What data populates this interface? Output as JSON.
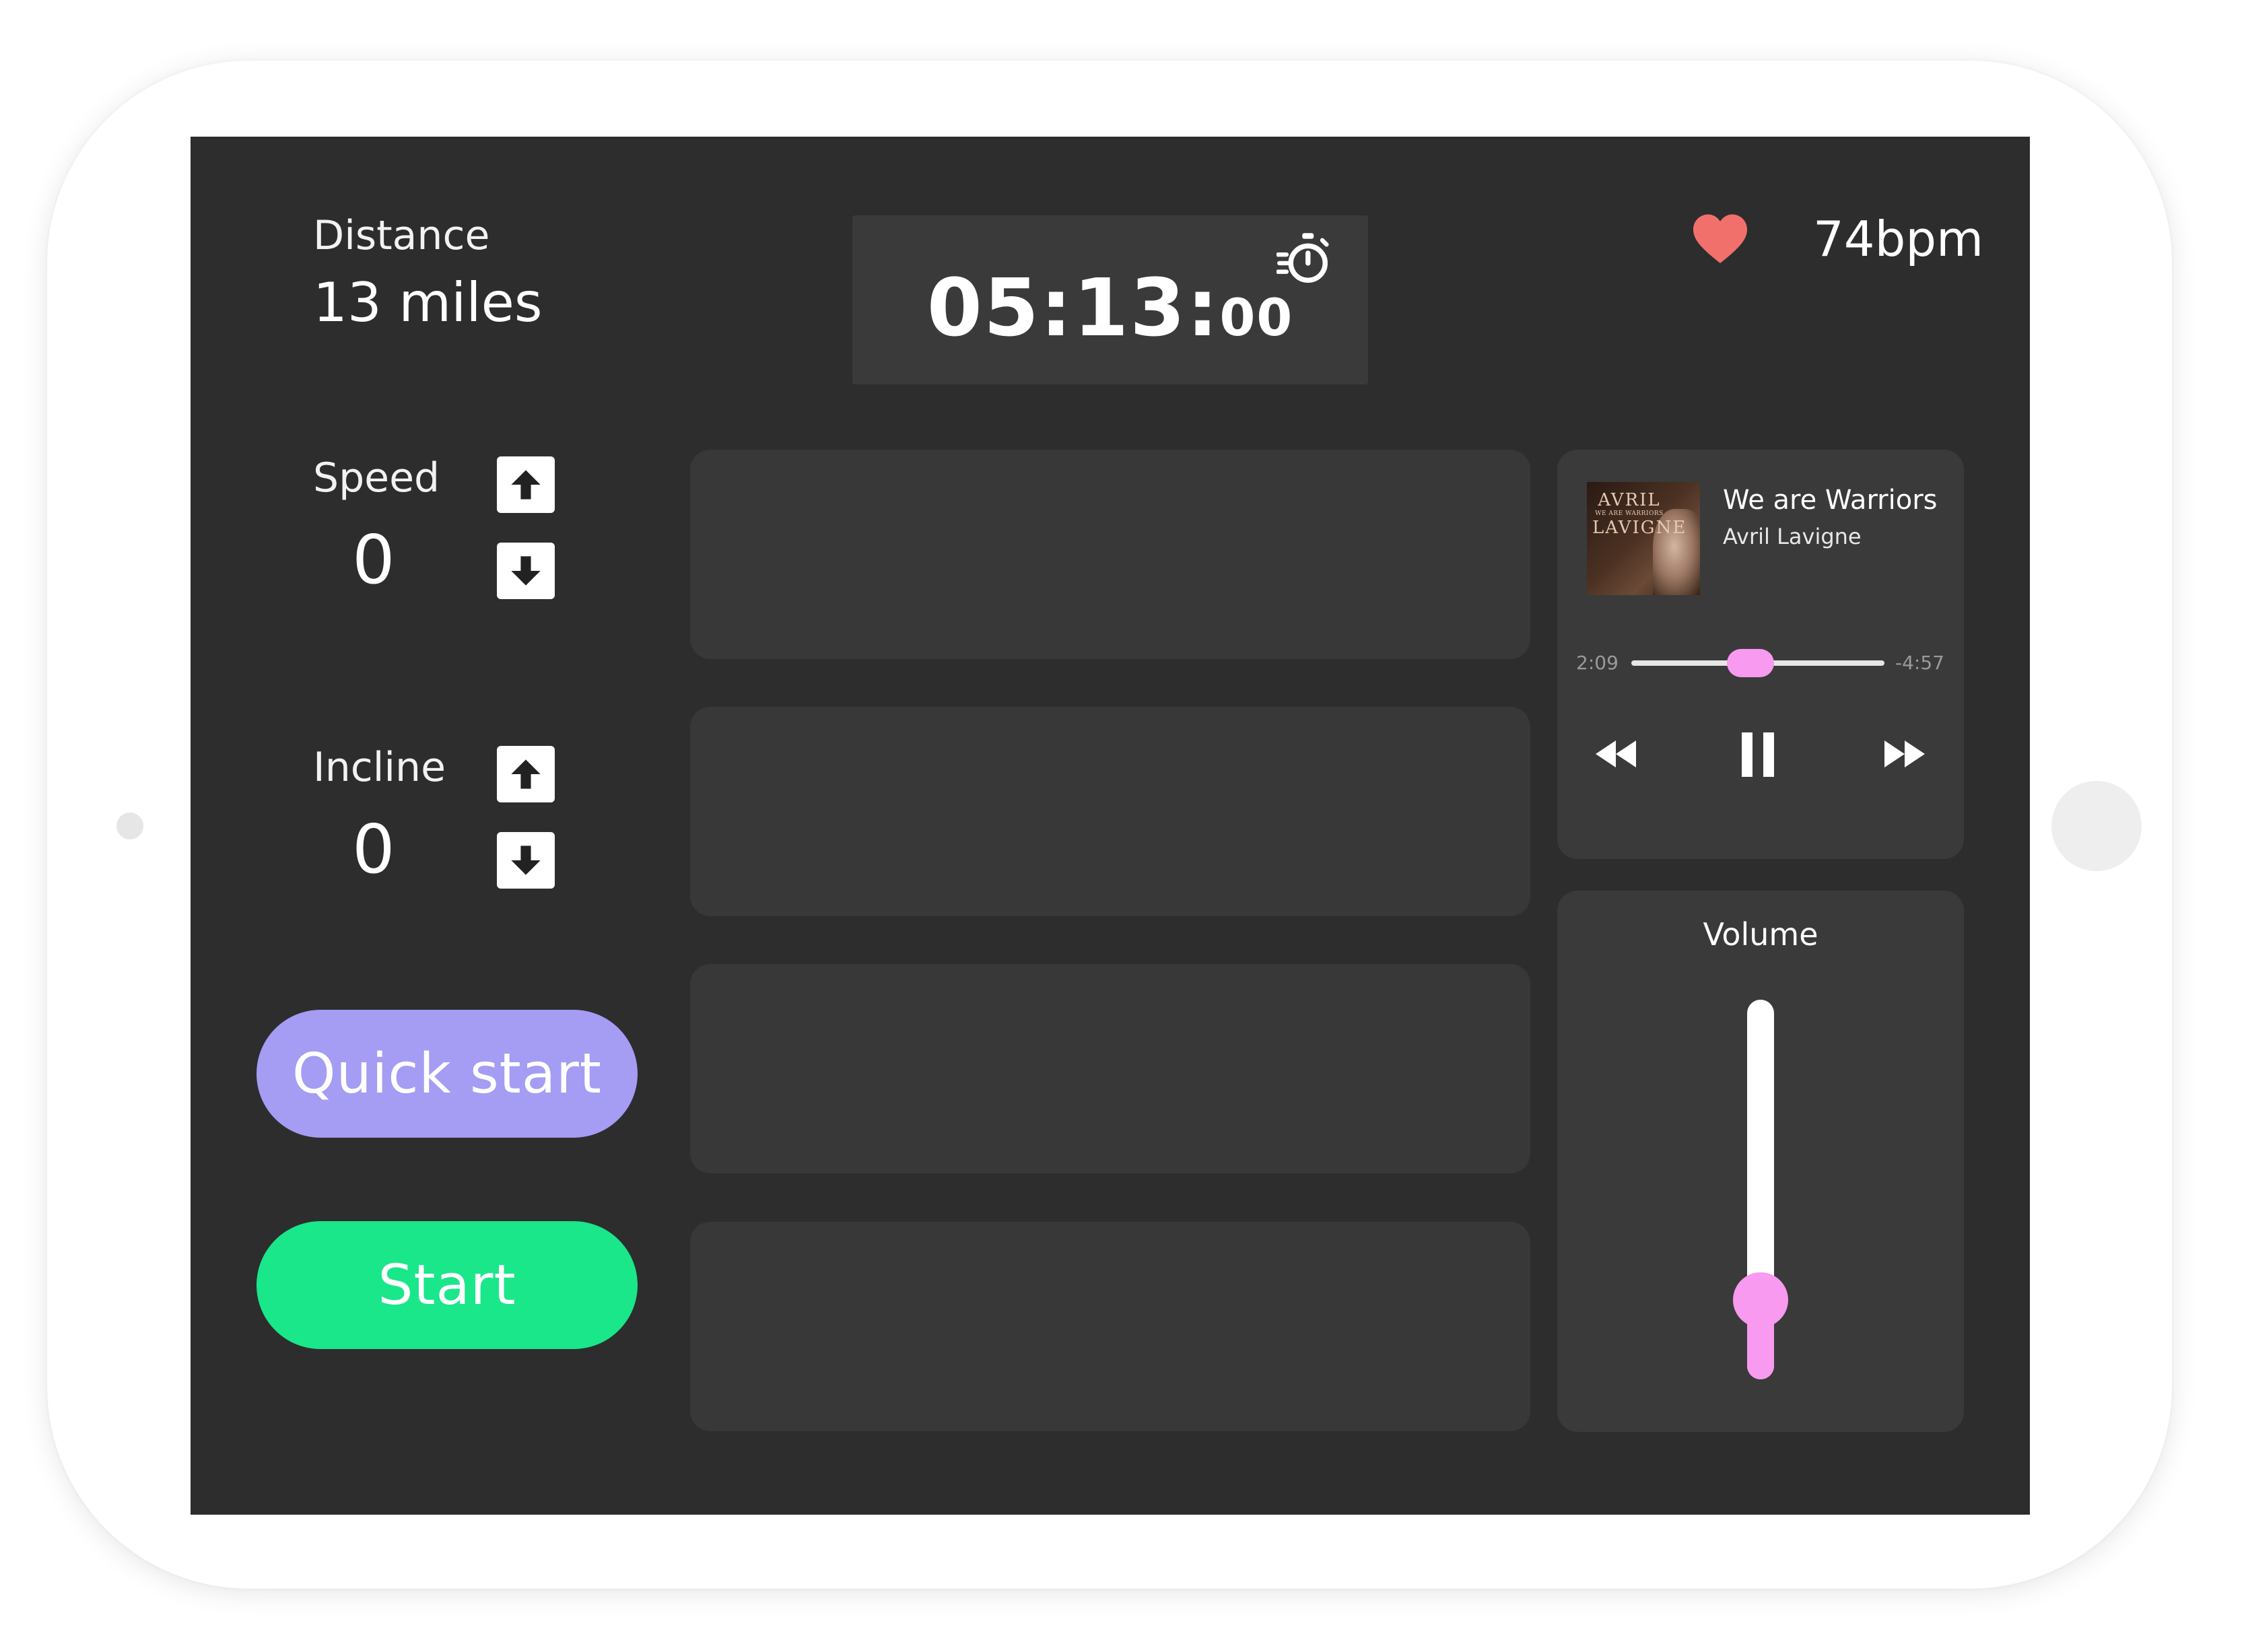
{
  "stats": {
    "distance_label": "Distance",
    "distance_value": "13 miles",
    "heart_rate": "74bpm"
  },
  "timer": {
    "main": "05:13:",
    "fraction": "00",
    "icon": "stopwatch-icon"
  },
  "controls": {
    "speed_label": "Speed",
    "speed_value": "0",
    "incline_label": "Incline",
    "incline_value": "0",
    "arrow_up_icon": "arrow-up-icon",
    "arrow_down_icon": "arrow-down-icon"
  },
  "buttons": {
    "quick_start": "Quick start",
    "start": "Start"
  },
  "player": {
    "title": "We are Warriors",
    "artist": "Avril Lavigne",
    "album_art_text": [
      "AVRIL",
      "WE ARE WARRIORS",
      "LAVIGNE"
    ],
    "elapsed": "2:09",
    "remaining": "-4:57",
    "progress_fraction": 0.47,
    "icons": [
      "rewind-icon",
      "pause-icon",
      "fast-forward-icon"
    ]
  },
  "volume": {
    "label": "Volume",
    "level_fraction": 0.21
  },
  "colors": {
    "screen_bg": "#2d2d2d",
    "panel_bg": "#383838",
    "accent_pink": "#f79af0",
    "quick_start": "#a59cf4",
    "start": "#1ae68a",
    "heart": "#f2706b"
  }
}
